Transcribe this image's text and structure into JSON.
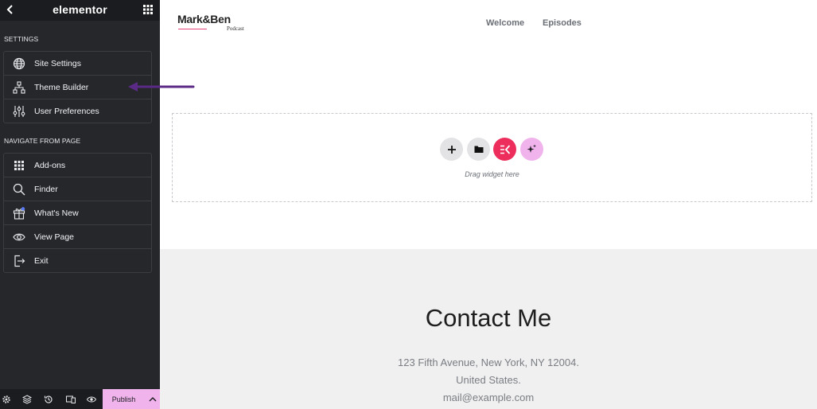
{
  "header": {
    "logo": "elementor"
  },
  "sections": [
    {
      "label": "SETTINGS",
      "items": [
        {
          "label": "Site Settings",
          "icon": "globe-icon"
        },
        {
          "label": "Theme Builder",
          "icon": "sitemap-icon"
        },
        {
          "label": "User Preferences",
          "icon": "sliders-icon"
        }
      ]
    },
    {
      "label": "NAVIGATE FROM PAGE",
      "items": [
        {
          "label": "Add-ons",
          "icon": "grid-icon"
        },
        {
          "label": "Finder",
          "icon": "search-icon"
        },
        {
          "label": "What's New",
          "icon": "gift-icon"
        },
        {
          "label": "View Page",
          "icon": "eye-icon"
        },
        {
          "label": "Exit",
          "icon": "exit-icon"
        }
      ]
    }
  ],
  "bottombar": {
    "publish_label": "Publish"
  },
  "site": {
    "brand": "Mark&Ben",
    "brand_sub": "Podcast",
    "nav": [
      "Welcome",
      "Episodes"
    ],
    "drop_hint": "Drag widget here",
    "contact_title": "Contact Me",
    "contact_lines": [
      "123 Fifth Avenue, New York, NY 12004.",
      "United States.",
      "mail@example.com"
    ]
  },
  "colors": {
    "accent_pink": "#f0b3ec",
    "elementor_red": "#ed2e5c",
    "annotation_purple": "#5b2a86",
    "sidebar_bg": "#26272b"
  }
}
